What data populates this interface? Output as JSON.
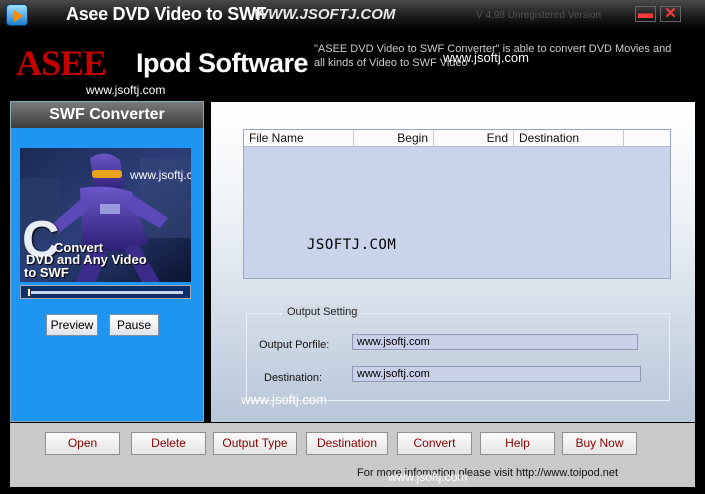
{
  "window": {
    "title": "Asee DVD Video to SWF",
    "title_watermark": "WWW.JSOFTJ.COM",
    "version": "V 4.98 Unregistered Version",
    "minimize_glyph": "▬",
    "close_glyph": "✕"
  },
  "header": {
    "brand": "ASEE",
    "product": "Ipod Software",
    "site": "www.jsoftj.com",
    "description": "\"ASEE DVD Video to SWF Converter\" is able to convert DVD Movies and all kinds of  Video to SWF Video",
    "watermark": "www.jsoftj.com"
  },
  "left_panel": {
    "title": "SWF Converter",
    "preview_caption_line1": "Convert",
    "preview_caption_line2": "DVD and Any Video",
    "preview_caption_line3": "to SWF",
    "preview_big_letter": "C",
    "watermark": "www.jsoftj.com",
    "progress": 0.0,
    "preview_button": "Preview",
    "pause_button": "Pause"
  },
  "file_list": {
    "columns": [
      "File Name",
      "Begin",
      "End",
      "Destination"
    ],
    "rows": [],
    "watermark": "JSOFTJ.COM"
  },
  "output_setting": {
    "label": "Output Setting",
    "profile_label": "Output Porfile:",
    "profile_value": "www.jsoftj.com",
    "destination_label": "Destination:",
    "destination_value": "www.jsoftj.com",
    "watermark": "www.jsoftj.com"
  },
  "toolbar": {
    "buttons": [
      "Open",
      "Delete",
      "Output Type",
      "Destination",
      "Convert",
      "Help",
      "Buy Now"
    ]
  },
  "footer": {
    "text": "For more infomation please visit http://www.toipod.net",
    "watermark": "www.jsoftj.com"
  },
  "colors": {
    "brand_red": "#c40000",
    "panel_blue": "#1e95f0",
    "button_text": "#8b0000"
  }
}
